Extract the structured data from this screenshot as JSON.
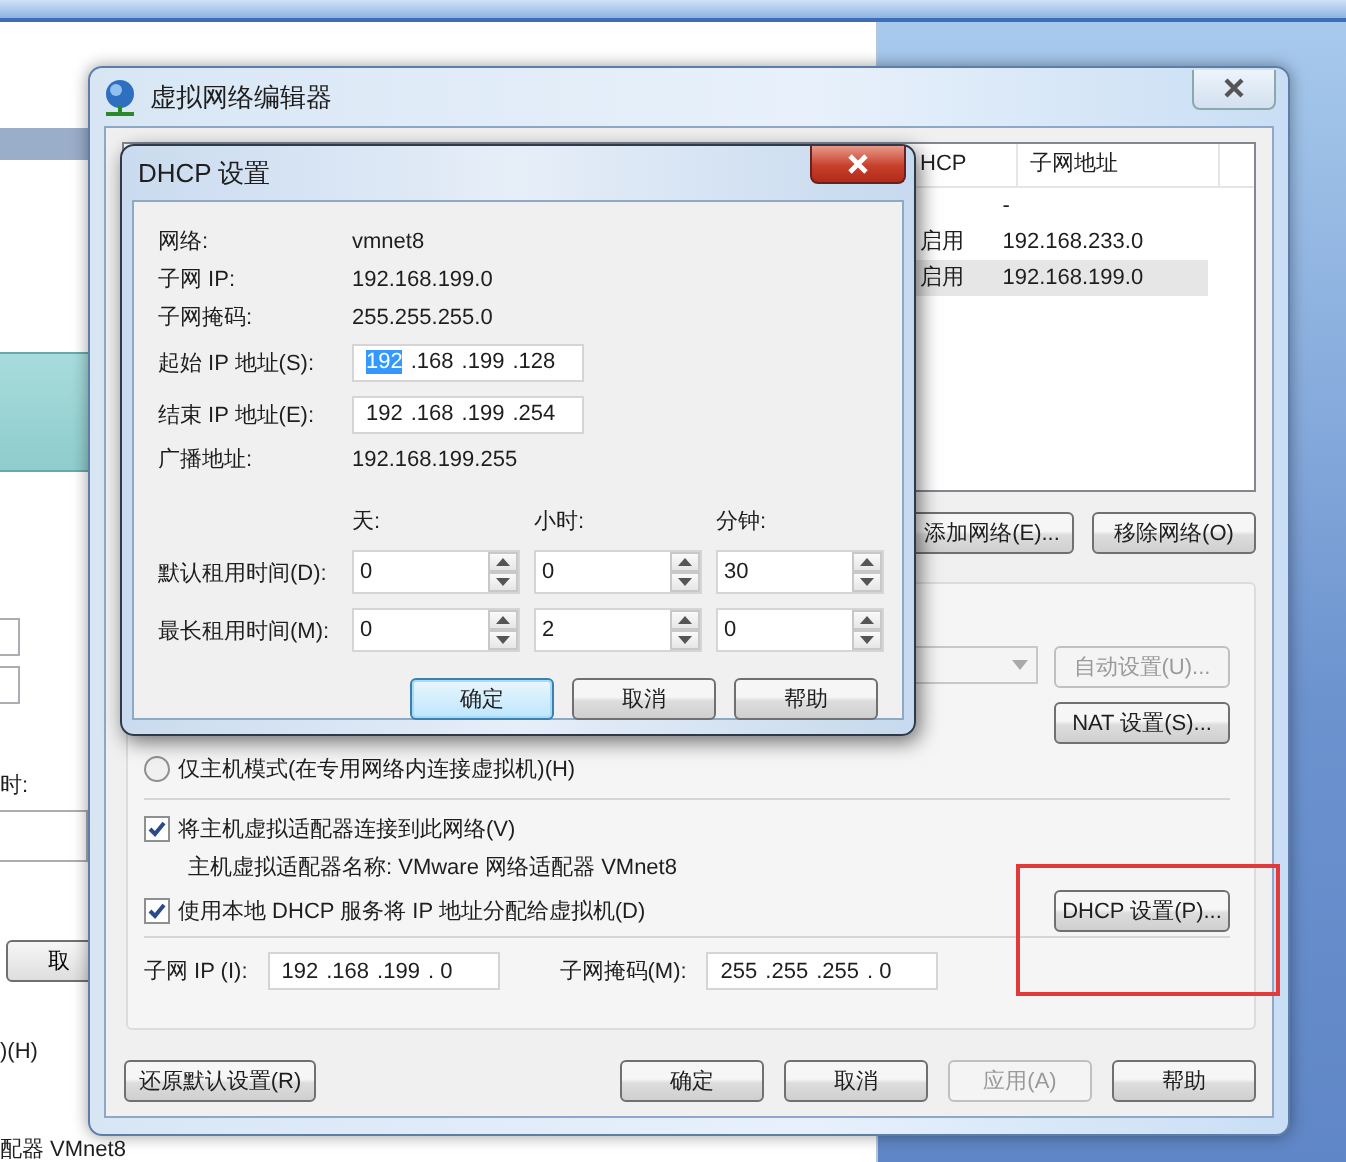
{
  "back_window": {
    "time_label": "时:",
    "button": "取",
    "radio_tail": ")(H)",
    "adapter_tail": "配器 VMnet8"
  },
  "main_window": {
    "title": "虚拟网络编辑器",
    "network_table": {
      "columns": [
        "HCP",
        "子网地址"
      ],
      "rows": [
        {
          "cells": [
            "",
            "-"
          ],
          "selected": false
        },
        {
          "cells": [
            "启用",
            "192.168.233.0"
          ],
          "selected": false
        },
        {
          "cells": [
            "启用",
            "192.168.199.0"
          ],
          "selected": true
        }
      ]
    },
    "network_buttons": [
      "添加网络(E)...",
      "移除网络(O)"
    ],
    "nat_dropdown": {
      "disabled": true
    },
    "auto_button": {
      "label": "自动设置(U)...",
      "disabled": true
    },
    "nat_button": {
      "label": "NAT 设置(S)...",
      "disabled": false
    },
    "host_only": {
      "label": "仅主机模式(在专用网络内连接虚拟机)(H)",
      "selected": false
    },
    "connect_adapter": {
      "label": "将主机虚拟适配器连接到此网络(V)",
      "checked": true
    },
    "adapter_name": "主机虚拟适配器名称: VMware 网络适配器 VMnet8",
    "dhcp_service": {
      "label": "使用本地 DHCP 服务将 IP 地址分配给虚拟机(D)",
      "checked": true
    },
    "dhcp_button": {
      "label": "DHCP 设置(P)...",
      "disabled": false
    },
    "subnet_ip": {
      "label": "子网 IP (I):",
      "octets": [
        {
          "text": "192",
          "selected": false
        },
        {
          "text": ".168",
          "selected": false
        },
        {
          "text": ".199",
          "selected": false
        },
        {
          "text": ". 0",
          "selected": false
        }
      ]
    },
    "subnet_mask": {
      "label": "子网掩码(M):",
      "octets": [
        {
          "text": "255",
          "selected": false
        },
        {
          "text": ".255",
          "selected": false
        },
        {
          "text": ".255",
          "selected": false
        },
        {
          "text": ". 0",
          "selected": false
        }
      ]
    },
    "restore_button": {
      "label": "还原默认设置(R)",
      "disabled": false
    },
    "footer_buttons": [
      {
        "label": "确定",
        "disabled": false
      },
      {
        "label": "取消",
        "disabled": false
      },
      {
        "label": "应用(A)",
        "disabled": true
      },
      {
        "label": "帮助",
        "disabled": false
      }
    ]
  },
  "dhcp_dialog": {
    "title": "DHCP 设置",
    "rows": [
      {
        "kind": "text",
        "label": "网络:",
        "value": "vmnet8"
      },
      {
        "kind": "text",
        "label": "子网 IP:",
        "value": "192.168.199.0"
      },
      {
        "kind": "text",
        "label": "子网掩码:",
        "value": "255.255.255.0"
      },
      {
        "kind": "ip",
        "label": "起始 IP 地址(S):",
        "octets": [
          {
            "text": "192",
            "selected": true
          },
          {
            "text": ".168",
            "selected": false
          },
          {
            "text": ".199",
            "selected": false
          },
          {
            "text": ".128",
            "selected": false
          }
        ]
      },
      {
        "kind": "ip",
        "label": "结束 IP 地址(E):",
        "octets": [
          {
            "text": "192",
            "selected": false
          },
          {
            "text": ".168",
            "selected": false
          },
          {
            "text": ".199",
            "selected": false
          },
          {
            "text": ".254",
            "selected": false
          }
        ]
      },
      {
        "kind": "text",
        "label": "广播地址:",
        "value": "192.168.199.255"
      }
    ],
    "lease_headers": [
      "天:",
      "小时:",
      "分钟:"
    ],
    "lease_rows": [
      {
        "label": "默认租用时间(D):",
        "values": [
          "0",
          "0",
          "30"
        ]
      },
      {
        "label": "最长租用时间(M):",
        "values": [
          "0",
          "2",
          "0"
        ]
      }
    ],
    "buttons": [
      {
        "label": "确定",
        "default": true
      },
      {
        "label": "取消",
        "default": false
      },
      {
        "label": "帮助",
        "default": false
      }
    ]
  }
}
